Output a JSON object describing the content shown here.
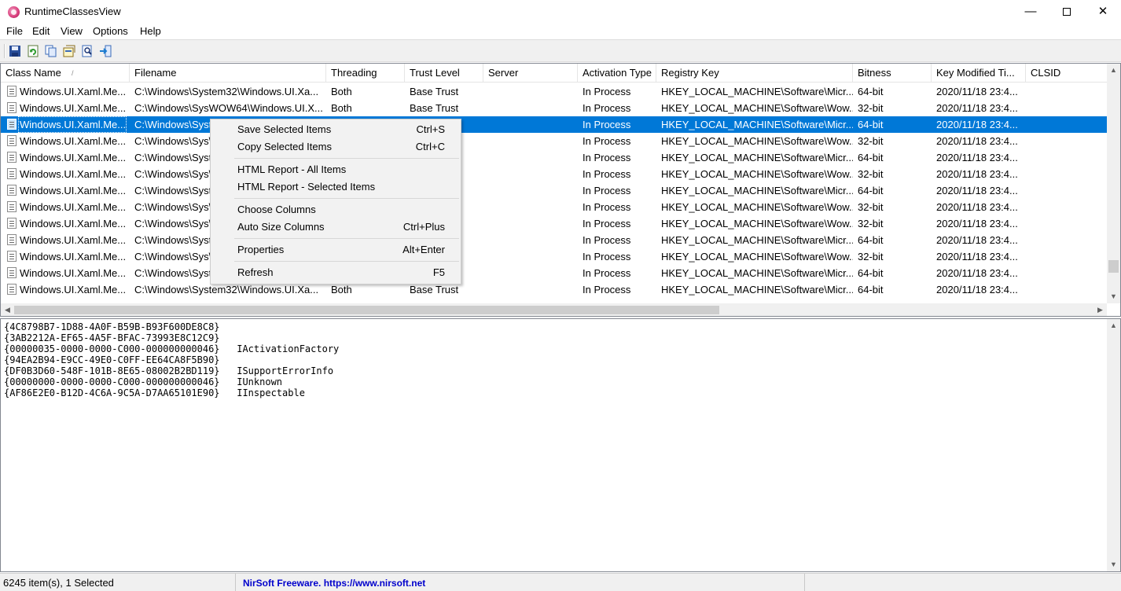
{
  "window": {
    "title": "RuntimeClassesView",
    "minimize_glyph": "—",
    "close_glyph": "✕"
  },
  "menu": [
    "File",
    "Edit",
    "View",
    "Options",
    "Help"
  ],
  "toolbar": {
    "icons": [
      "save-icon",
      "refresh-icon",
      "copy-icon",
      "html-report-icon",
      "find-icon",
      "exit-icon"
    ]
  },
  "columns": [
    "Class Name",
    "Filename",
    "Threading",
    "Trust Level",
    "Server",
    "Activation Type",
    "Registry Key",
    "Bitness",
    "Key Modified Ti...",
    "CLSID"
  ],
  "sort_arrow": "/",
  "rows": [
    [
      "Windows.UI.Xaml.Me...",
      "C:\\Windows\\System32\\Windows.UI.Xa...",
      "Both",
      "Base Trust",
      "",
      "In Process",
      "HKEY_LOCAL_MACHINE\\Software\\Micr...",
      "64-bit",
      "2020/11/18 23:4...",
      ""
    ],
    [
      "Windows.UI.Xaml.Me...",
      "C:\\Windows\\SysWOW64\\Windows.UI.X...",
      "Both",
      "Base Trust",
      "",
      "In Process",
      "HKEY_LOCAL_MACHINE\\Software\\Wow...",
      "32-bit",
      "2020/11/18 23:4...",
      ""
    ],
    [
      "Windows.UI.Xaml.Me...",
      "C:\\Windows\\Syst",
      "",
      "",
      "",
      "In Process",
      "HKEY_LOCAL_MACHINE\\Software\\Micr...",
      "64-bit",
      "2020/11/18 23:4...",
      ""
    ],
    [
      "Windows.UI.Xaml.Me...",
      "C:\\Windows\\Sys\\",
      "",
      "",
      "",
      "In Process",
      "HKEY_LOCAL_MACHINE\\Software\\Wow...",
      "32-bit",
      "2020/11/18 23:4...",
      ""
    ],
    [
      "Windows.UI.Xaml.Me...",
      "C:\\Windows\\Syst",
      "",
      "",
      "",
      "In Process",
      "HKEY_LOCAL_MACHINE\\Software\\Micr...",
      "64-bit",
      "2020/11/18 23:4...",
      ""
    ],
    [
      "Windows.UI.Xaml.Me...",
      "C:\\Windows\\Sys\\",
      "",
      "",
      "",
      "In Process",
      "HKEY_LOCAL_MACHINE\\Software\\Wow...",
      "32-bit",
      "2020/11/18 23:4...",
      ""
    ],
    [
      "Windows.UI.Xaml.Me...",
      "C:\\Windows\\Syst",
      "",
      "",
      "",
      "In Process",
      "HKEY_LOCAL_MACHINE\\Software\\Micr...",
      "64-bit",
      "2020/11/18 23:4...",
      ""
    ],
    [
      "Windows.UI.Xaml.Me...",
      "C:\\Windows\\Sys\\",
      "",
      "",
      "",
      "In Process",
      "HKEY_LOCAL_MACHINE\\Software\\Wow...",
      "32-bit",
      "2020/11/18 23:4...",
      ""
    ],
    [
      "Windows.UI.Xaml.Me...",
      "C:\\Windows\\Sys\\",
      "",
      "",
      "",
      "In Process",
      "HKEY_LOCAL_MACHINE\\Software\\Wow...",
      "32-bit",
      "2020/11/18 23:4...",
      ""
    ],
    [
      "Windows.UI.Xaml.Me...",
      "C:\\Windows\\Syst",
      "",
      "",
      "",
      "In Process",
      "HKEY_LOCAL_MACHINE\\Software\\Micr...",
      "64-bit",
      "2020/11/18 23:4...",
      ""
    ],
    [
      "Windows.UI.Xaml.Me...",
      "C:\\Windows\\Sys\\",
      "",
      "",
      "",
      "In Process",
      "HKEY_LOCAL_MACHINE\\Software\\Wow...",
      "32-bit",
      "2020/11/18 23:4...",
      ""
    ],
    [
      "Windows.UI.Xaml.Me...",
      "C:\\Windows\\Syst",
      "",
      "",
      "",
      "In Process",
      "HKEY_LOCAL_MACHINE\\Software\\Micr...",
      "64-bit",
      "2020/11/18 23:4...",
      ""
    ],
    [
      "Windows.UI.Xaml.Me...",
      "C:\\Windows\\System32\\Windows.UI.Xa...",
      "Both",
      "Base Trust",
      "",
      "In Process",
      "HKEY_LOCAL_MACHINE\\Software\\Micr...",
      "64-bit",
      "2020/11/18 23:4...",
      ""
    ]
  ],
  "selected_row": 2,
  "context_menu": {
    "groups": [
      [
        {
          "label": "Save Selected Items",
          "shortcut": "Ctrl+S"
        },
        {
          "label": "Copy Selected Items",
          "shortcut": "Ctrl+C"
        }
      ],
      [
        {
          "label": "HTML Report - All Items",
          "shortcut": ""
        },
        {
          "label": "HTML Report - Selected Items",
          "shortcut": ""
        }
      ],
      [
        {
          "label": "Choose Columns",
          "shortcut": ""
        },
        {
          "label": "Auto Size Columns",
          "shortcut": "Ctrl+Plus"
        }
      ],
      [
        {
          "label": "Properties",
          "shortcut": "Alt+Enter"
        }
      ],
      [
        {
          "label": "Refresh",
          "shortcut": "F5"
        }
      ]
    ]
  },
  "lower_pane": {
    "lines": [
      [
        "{4C8798B7-1D88-4A0F-B59B-B93F600DE8C8}",
        ""
      ],
      [
        "{3AB2212A-EF65-4A5F-BFAC-73993E8C12C9}",
        ""
      ],
      [
        "{00000035-0000-0000-C000-000000000046}",
        "IActivationFactory"
      ],
      [
        "{94EA2B94-E9CC-49E0-C0FF-EE64CA8F5B90}",
        ""
      ],
      [
        "{DF0B3D60-548F-101B-8E65-08002B2BD119}",
        "ISupportErrorInfo"
      ],
      [
        "{00000000-0000-0000-C000-000000000046}",
        "IUnknown"
      ],
      [
        "{AF86E2E0-B12D-4C6A-9C5A-D7AA65101E90}",
        "IInspectable"
      ]
    ]
  },
  "status": {
    "count": "6245 item(s), 1 Selected",
    "link": "NirSoft Freeware. https://www.nirsoft.net"
  },
  "colors": {
    "selection": "#0078d7",
    "link": "#0000cc",
    "menu_bg": "#f2f2f2"
  }
}
